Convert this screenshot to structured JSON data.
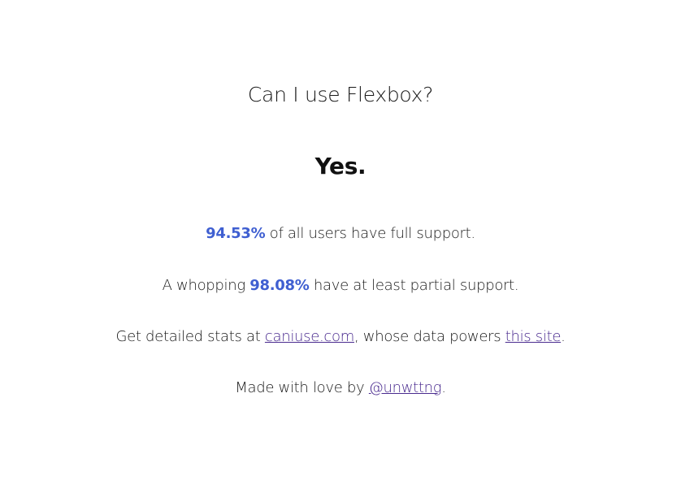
{
  "question": "Can I use Flexbox?",
  "answer": "Yes.",
  "full_support": {
    "percent": "94.53%",
    "suffix": " of all users have full support."
  },
  "partial_support": {
    "prefix": "A whopping ",
    "percent": "98.08%",
    "suffix": " have at least partial support."
  },
  "stats_line": {
    "prefix": "Get detailed stats at ",
    "link1": "caniuse.com",
    "middle": ", whose data powers ",
    "link2": "this site",
    "suffix": "."
  },
  "credit_line": {
    "prefix": "Made with love by ",
    "link": "@unwttng",
    "suffix": "."
  },
  "colors": {
    "accent": "#3f5fd1",
    "link": "#4a2b8f",
    "text": "#1a1a1a",
    "background": "#ffffff"
  }
}
